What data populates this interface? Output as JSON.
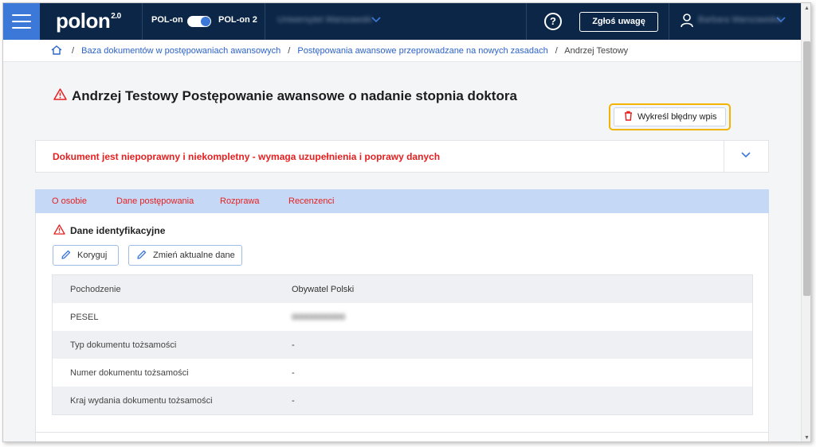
{
  "header": {
    "logo": "polon",
    "logo_version": "2.0",
    "env_left": "POL-on",
    "env_right": "POL-on 2",
    "university": "Uniwersytet Warszawski",
    "help_label": "?",
    "report_button": "Zgłoś uwagę",
    "user_name": "Barbara Warszawska"
  },
  "breadcrumb": {
    "items": [
      "Baza dokumentów w postępowaniach awansowych",
      "Postępowania awansowe przeprowadzane na nowych zasadach"
    ],
    "current": "Andrzej Testowy"
  },
  "page": {
    "title": "Andrzej Testowy Postępowanie awansowe o nadanie stopnia doktora",
    "strike_button": "Wykreśl błędny wpis"
  },
  "alert": {
    "text": "Dokument jest niepoprawny i niekompletny - wymaga uzupełnienia i poprawy danych"
  },
  "tabs": [
    "O osobie",
    "Dane postępowania",
    "Rozprawa",
    "Recenzenci"
  ],
  "section": {
    "title": "Dane identyfikacyjne",
    "correct_button": "Koryguj",
    "change_button": "Zmień aktualne dane",
    "rows": [
      {
        "label": "Pochodzenie",
        "value": "Obywatel Polski"
      },
      {
        "label": "PESEL",
        "value": "00000000000"
      },
      {
        "label": "Typ dokumentu tożsamości",
        "value": "-"
      },
      {
        "label": "Numer dokumentu tożsamości",
        "value": "-"
      },
      {
        "label": "Kraj wydania dokumentu tożsamości",
        "value": "-"
      }
    ]
  },
  "colors": {
    "topbar": "#0b2647",
    "accent": "#3c78d8",
    "error": "#e62020",
    "highlight": "#f2b400",
    "tabs_bg": "#c5d8f5"
  },
  "icons": [
    "menu-icon",
    "chevron-down-icon",
    "help-icon",
    "user-icon",
    "home-icon",
    "warning-icon",
    "trash-icon",
    "pencil-icon"
  ]
}
